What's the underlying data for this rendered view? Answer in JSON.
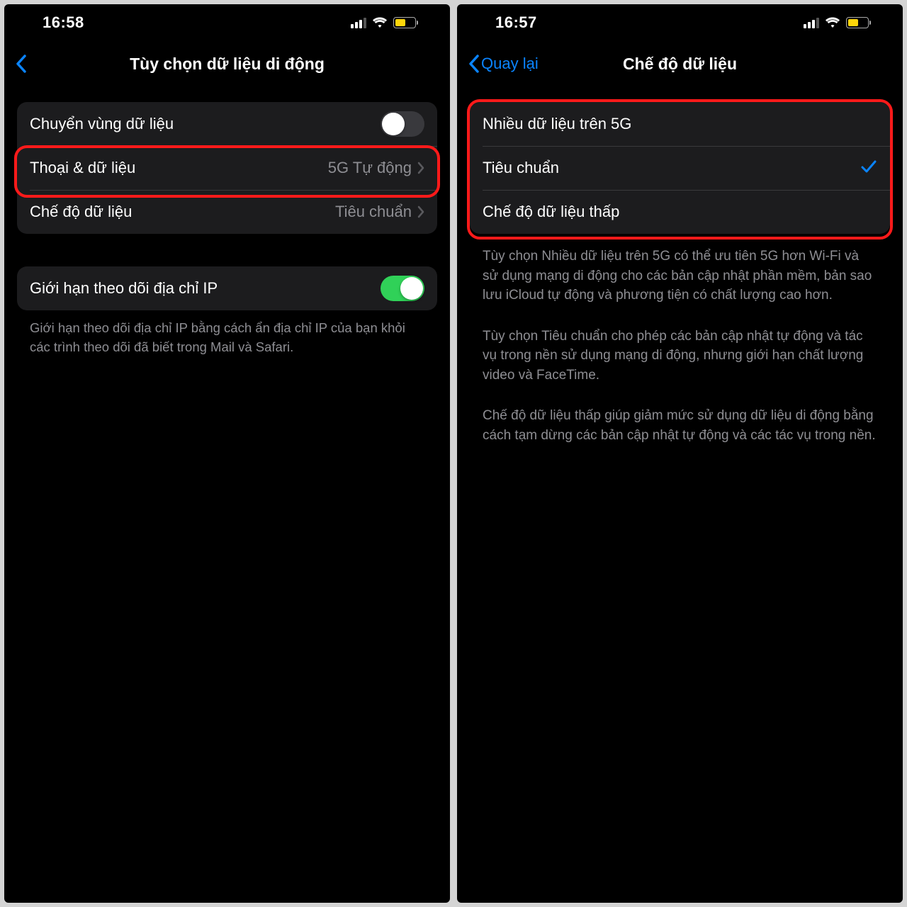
{
  "left": {
    "time": "16:58",
    "title": "Tùy chọn dữ liệu di động",
    "rows": {
      "roaming": "Chuyển vùng dữ liệu",
      "voice_data_label": "Thoại & dữ liệu",
      "voice_data_value": "5G Tự động",
      "data_mode_label": "Chế độ dữ liệu",
      "data_mode_value": "Tiêu chuẩn",
      "limit_ip": "Giới hạn theo dõi địa chỉ IP"
    },
    "footer": "Giới hạn theo dõi địa chỉ IP bằng cách ẩn địa chỉ IP của bạn khỏi các trình theo dõi đã biết trong Mail và Safari."
  },
  "right": {
    "time": "16:57",
    "back_label": "Quay lại",
    "title": "Chế độ dữ liệu",
    "options": {
      "o1": "Nhiều dữ liệu trên 5G",
      "o2": "Tiêu chuẩn",
      "o3": "Chế độ dữ liệu thấp"
    },
    "p1": "Tùy chọn Nhiều dữ liệu trên 5G có thể ưu tiên 5G hơn Wi-Fi và sử dụng mạng di động cho các bản cập nhật phần mềm, bản sao lưu iCloud tự động và phương tiện có chất lượng cao hơn.",
    "p2": "Tùy chọn Tiêu chuẩn cho phép các bản cập nhật tự động và tác vụ trong nền sử dụng mạng di động, nhưng giới hạn chất lượng video và FaceTime.",
    "p3": "Chế độ dữ liệu thấp giúp giảm mức sử dụng dữ liệu di động bằng cách tạm dừng các bản cập nhật tự động và các tác vụ trong nền."
  }
}
